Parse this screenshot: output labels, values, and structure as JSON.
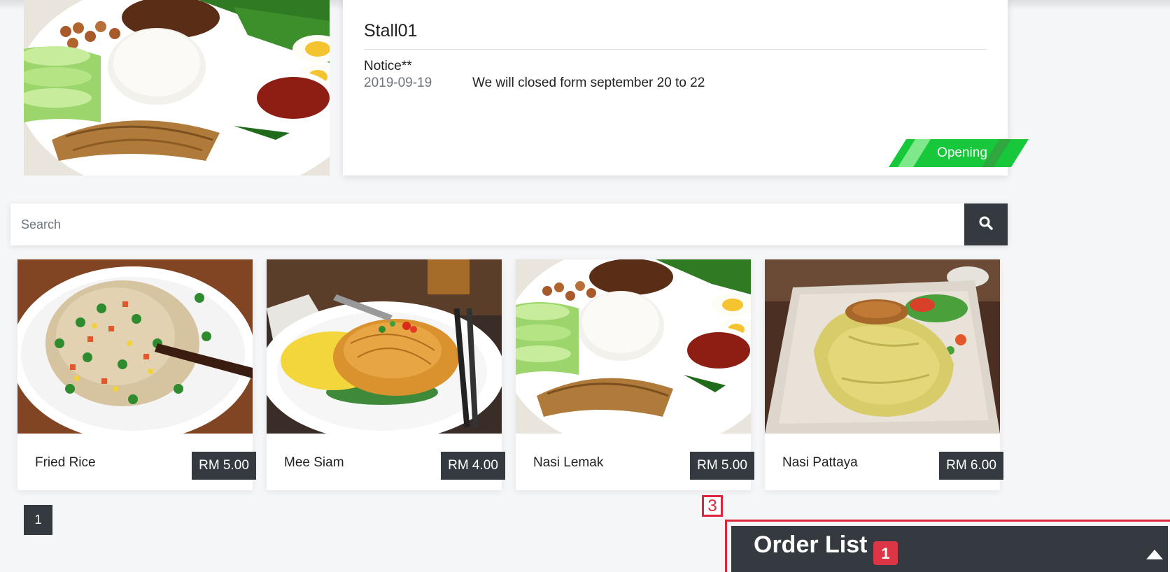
{
  "stall": {
    "name": "Stall01",
    "notice_title": "Notice**",
    "notice_date": "2019-09-19",
    "notice_text": "We will closed form september 20 to 22",
    "status": "Opening",
    "status_color": "#16c83a"
  },
  "search": {
    "placeholder": "Search",
    "icon": "search-icon"
  },
  "menu": {
    "items": [
      {
        "name": "Fried Rice",
        "price": "RM 5.00"
      },
      {
        "name": "Mee Siam",
        "price": "RM 4.00"
      },
      {
        "name": "Nasi Lemak",
        "price": "RM 5.00"
      },
      {
        "name": "Nasi Pattaya",
        "price": "RM 6.00"
      }
    ]
  },
  "pagination": {
    "current_page": "1"
  },
  "annotation": {
    "marker": "3",
    "color": "#e0243b"
  },
  "order_list": {
    "title": "Order List",
    "count": "1",
    "toggle_icon": "caret-up-icon"
  }
}
